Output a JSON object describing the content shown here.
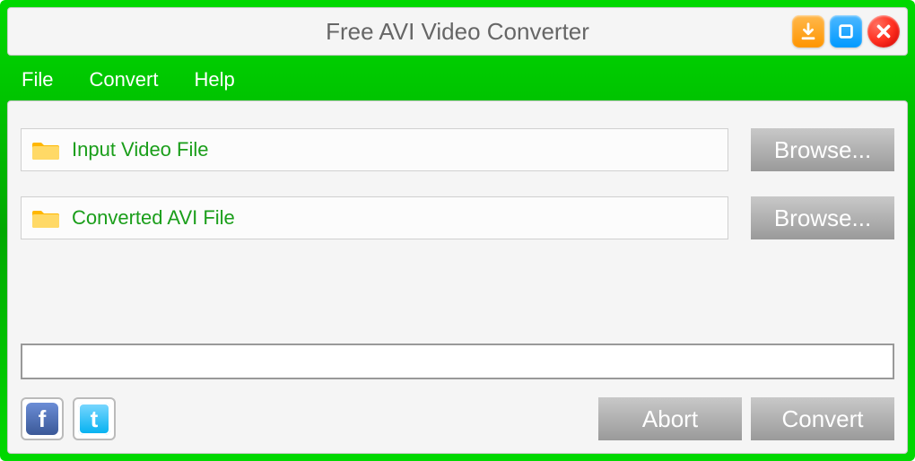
{
  "title": "Free AVI Video Converter",
  "menu": {
    "file": "File",
    "convert": "Convert",
    "help": "Help"
  },
  "fields": {
    "input": "Input Video File",
    "output": "Converted AVI File"
  },
  "buttons": {
    "browse": "Browse...",
    "abort": "Abort",
    "convert": "Convert"
  },
  "colors": {
    "accent": "#00c800",
    "label": "#1a9e1a"
  }
}
